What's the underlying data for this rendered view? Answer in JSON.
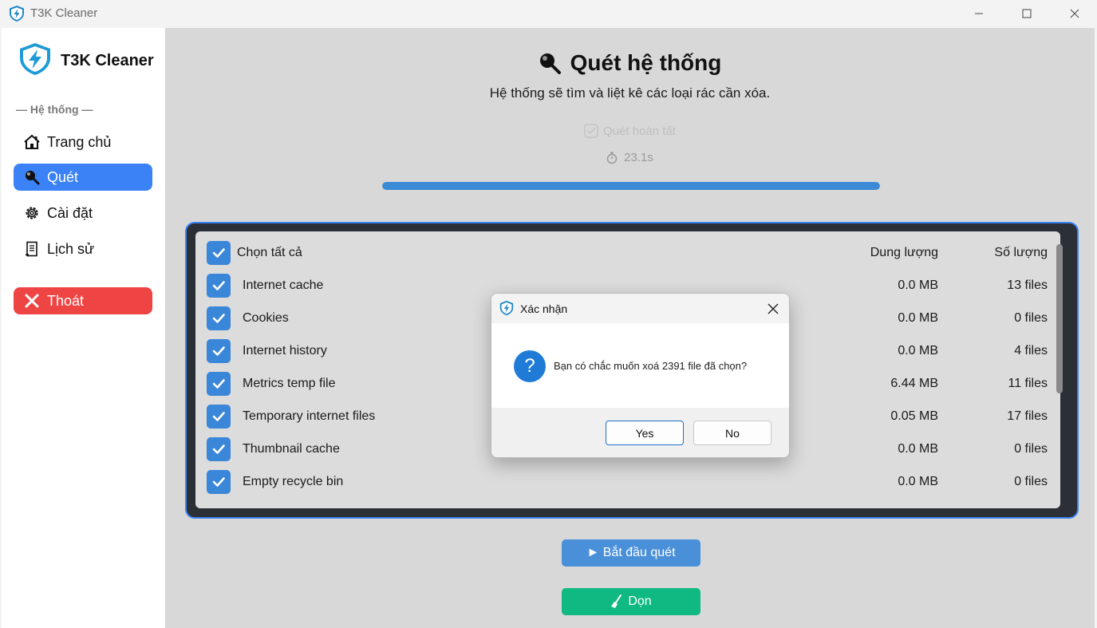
{
  "window": {
    "title": "T3K Cleaner",
    "icon": "lightning-shield-icon",
    "controls": [
      "minimize-icon",
      "maximize-icon",
      "close-icon"
    ]
  },
  "sidebar": {
    "brand": "T3K Cleaner",
    "section_label": "— Hệ thống —",
    "items": [
      {
        "label": "Trang chủ",
        "icon": "home-icon"
      },
      {
        "label": "Quét",
        "icon": "magnifier-icon",
        "active": true
      },
      {
        "label": "Cài đặt",
        "icon": "gear-icon"
      },
      {
        "label": "Lịch sử",
        "icon": "scroll-icon"
      }
    ],
    "exit": {
      "label": "Thoát",
      "icon": "x-icon"
    }
  },
  "main": {
    "title": "Quét hệ thống",
    "subtitle": "Hệ thống sẽ tìm và liệt kê các loại rác cần xóa.",
    "status": "Quét hoàn tất",
    "elapsed": "23.1s",
    "progress": 1.0,
    "table": {
      "select_all": "Chọn tất cả",
      "col_size": "Dung lượng",
      "col_count": "Số lượng",
      "rows": [
        {
          "name": "Internet cache",
          "size": "0.0 MB",
          "count": "13 files",
          "checked": true
        },
        {
          "name": "Cookies",
          "size": "0.0 MB",
          "count": "0 files",
          "checked": true
        },
        {
          "name": "Internet history",
          "size": "0.0 MB",
          "count": "4 files",
          "checked": true
        },
        {
          "name": "Metrics temp file",
          "size": "6.44 MB",
          "count": "11 files",
          "checked": true
        },
        {
          "name": "Temporary internet files",
          "size": "0.05 MB",
          "count": "17 files",
          "checked": true
        },
        {
          "name": "Thumbnail cache",
          "size": "0.0 MB",
          "count": "0 files",
          "checked": true
        },
        {
          "name": "Empty recycle bin",
          "size": "0.0 MB",
          "count": "0 files",
          "checked": true
        }
      ]
    },
    "start_button": "► Bắt đầu quét",
    "clean_button": "Dọn"
  },
  "dialog": {
    "title": "Xác nhận",
    "message": "Bạn có chắc muốn xoá 2391 file đã chọn?",
    "yes": "Yes",
    "no": "No"
  },
  "colors": {
    "accent": "#3b82f6",
    "danger": "#ef4444",
    "success": "#10b981",
    "checkbox": "#3a86d8"
  }
}
